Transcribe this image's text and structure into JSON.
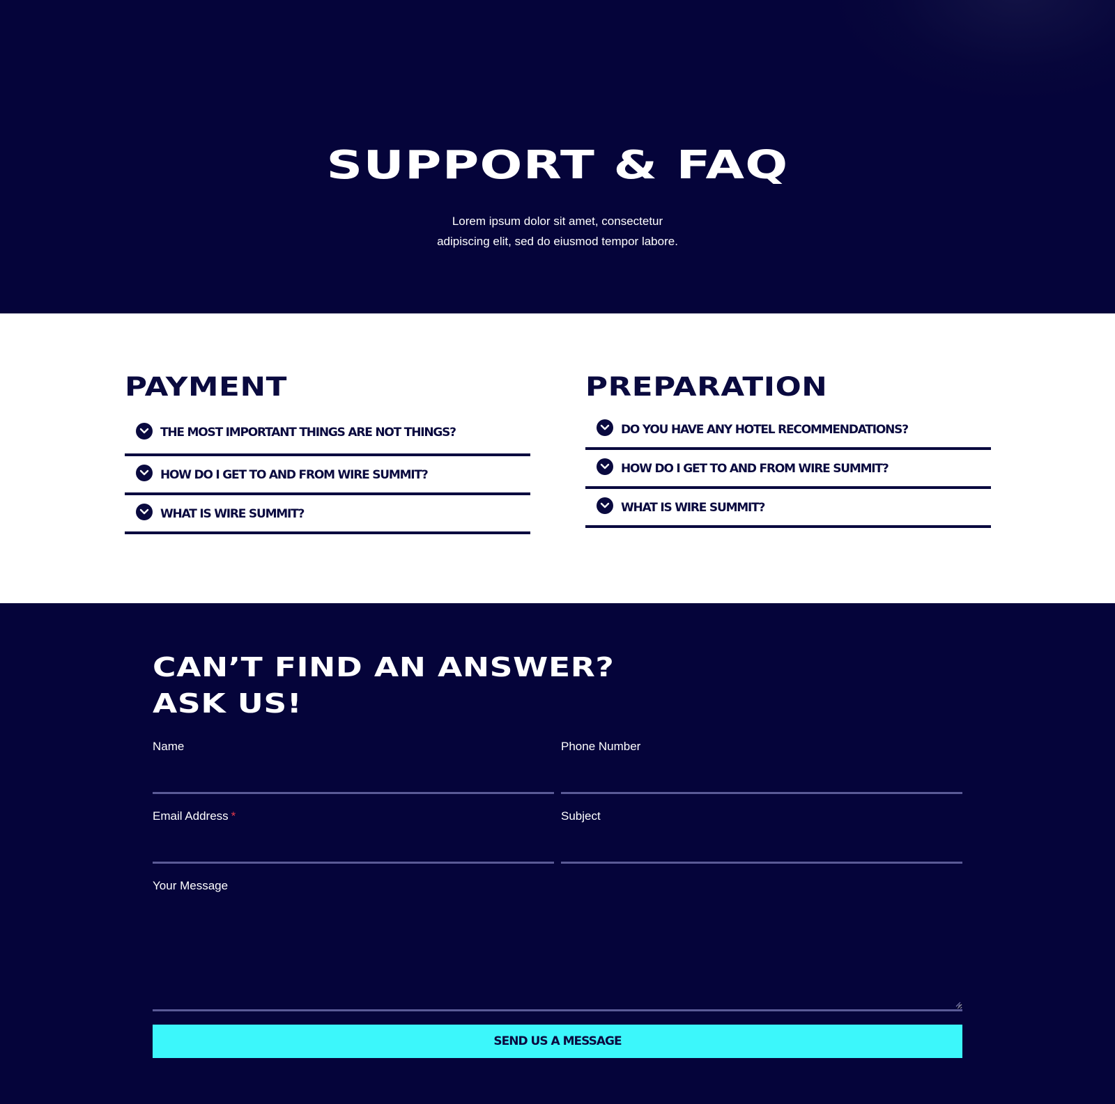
{
  "hero": {
    "title": "SUPPORT & FAQ",
    "subtitle_line1": "Lorem ipsum dolor sit amet, consectetur",
    "subtitle_line2": "adipiscing elit, sed do eiusmod tempor labore."
  },
  "faq": {
    "payment": {
      "title": "PAYMENT",
      "items": [
        {
          "question": "THE MOST IMPORTANT THINGS ARE NOT THINGS?"
        },
        {
          "question": "HOW DO I GET TO AND FROM WIRE SUMMIT?"
        },
        {
          "question": "WHAT IS WIRE SUMMIT?"
        }
      ]
    },
    "preparation": {
      "title": "PREPARATION",
      "items": [
        {
          "question": "DO YOU HAVE ANY HOTEL RECOMMENDATIONS?"
        },
        {
          "question": "HOW DO I GET TO AND FROM WIRE SUMMIT?"
        },
        {
          "question": "WHAT IS WIRE SUMMIT?"
        }
      ]
    },
    "item_icon": "chevron-down-circle-icon"
  },
  "contact": {
    "title": "CAN’T FIND AN ANSWER?\nASK US!",
    "fields": {
      "name": {
        "label": "Name",
        "value": ""
      },
      "phone": {
        "label": "Phone Number",
        "value": ""
      },
      "email": {
        "label": "Email Address",
        "required_mark": "*",
        "value": ""
      },
      "subject": {
        "label": "Subject",
        "value": ""
      },
      "message": {
        "label": "Your Message",
        "value": ""
      }
    },
    "submit_label": "SEND US A MESSAGE"
  },
  "colors": {
    "navy_background": "#05043a",
    "faq_text": "#0a0a3f",
    "button_cyan": "#3cf7fb",
    "input_underline": "#5a5a96",
    "required_red": "#e53a4a"
  }
}
